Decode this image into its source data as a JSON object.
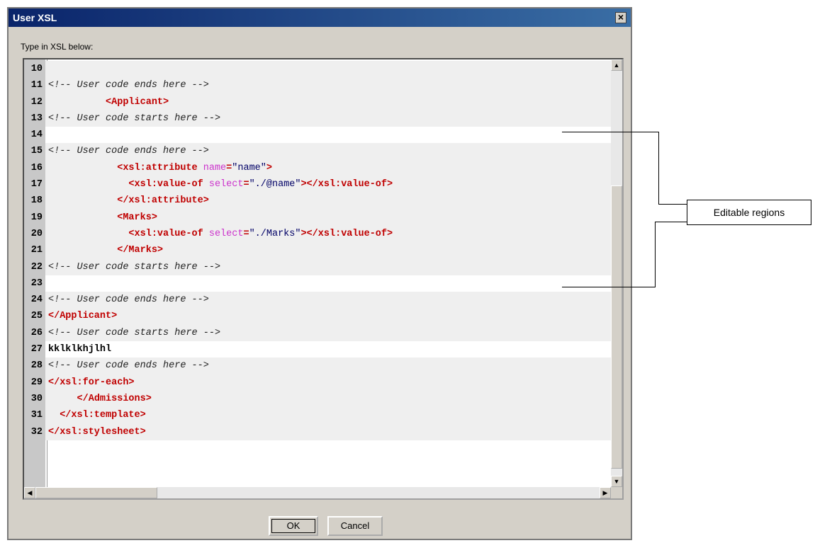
{
  "dialog": {
    "title": "User XSL",
    "close_label": "×",
    "prompt": "Type in XSL below:",
    "ok_label": "OK",
    "cancel_label": "Cancel"
  },
  "editor": {
    "lines": [
      {
        "num": "10",
        "kind": "readonly",
        "tokens": []
      },
      {
        "num": "11",
        "kind": "readonly",
        "tokens": [
          {
            "t": "comment",
            "v": "<!-- User code ends here -->"
          }
        ]
      },
      {
        "num": "12",
        "kind": "readonly",
        "tokens": [
          {
            "t": "text",
            "v": "          "
          },
          {
            "t": "tag",
            "v": "<Applicant>"
          }
        ]
      },
      {
        "num": "13",
        "kind": "readonly",
        "tokens": [
          {
            "t": "comment",
            "v": "<!-- User code starts here -->"
          }
        ]
      },
      {
        "num": "14",
        "kind": "editable",
        "tokens": []
      },
      {
        "num": "15",
        "kind": "readonly",
        "tokens": [
          {
            "t": "comment",
            "v": "<!-- User code ends here -->"
          }
        ]
      },
      {
        "num": "16",
        "kind": "readonly",
        "tokens": [
          {
            "t": "text",
            "v": "            "
          },
          {
            "t": "tag",
            "v": "<xsl:attribute "
          },
          {
            "t": "attrname",
            "v": "name"
          },
          {
            "t": "tag",
            "v": "="
          },
          {
            "t": "attrval",
            "v": "\"name\""
          },
          {
            "t": "tag",
            "v": ">"
          }
        ]
      },
      {
        "num": "17",
        "kind": "readonly",
        "tokens": [
          {
            "t": "text",
            "v": "              "
          },
          {
            "t": "tag",
            "v": "<xsl:value-of "
          },
          {
            "t": "attrname",
            "v": "select"
          },
          {
            "t": "tag",
            "v": "="
          },
          {
            "t": "attrval",
            "v": "\"./@name\""
          },
          {
            "t": "tag",
            "v": "></xsl:value-of>"
          }
        ]
      },
      {
        "num": "18",
        "kind": "readonly",
        "tokens": [
          {
            "t": "text",
            "v": "            "
          },
          {
            "t": "tag",
            "v": "</xsl:attribute>"
          }
        ]
      },
      {
        "num": "19",
        "kind": "readonly",
        "tokens": [
          {
            "t": "text",
            "v": "            "
          },
          {
            "t": "tag",
            "v": "<Marks>"
          }
        ]
      },
      {
        "num": "20",
        "kind": "readonly",
        "tokens": [
          {
            "t": "text",
            "v": "              "
          },
          {
            "t": "tag",
            "v": "<xsl:value-of "
          },
          {
            "t": "attrname",
            "v": "select"
          },
          {
            "t": "tag",
            "v": "="
          },
          {
            "t": "attrval",
            "v": "\"./Marks\""
          },
          {
            "t": "tag",
            "v": "></xsl:value-of>"
          }
        ]
      },
      {
        "num": "21",
        "kind": "readonly",
        "tokens": [
          {
            "t": "text",
            "v": "            "
          },
          {
            "t": "tag",
            "v": "</Marks>"
          }
        ]
      },
      {
        "num": "22",
        "kind": "readonly",
        "tokens": [
          {
            "t": "comment",
            "v": "<!-- User code starts here -->"
          }
        ]
      },
      {
        "num": "23",
        "kind": "editable",
        "tokens": []
      },
      {
        "num": "24",
        "kind": "readonly",
        "tokens": [
          {
            "t": "comment",
            "v": "<!-- User code ends here -->"
          }
        ]
      },
      {
        "num": "25",
        "kind": "readonly",
        "tokens": [
          {
            "t": "tag",
            "v": "</Applicant>"
          }
        ]
      },
      {
        "num": "26",
        "kind": "readonly",
        "tokens": [
          {
            "t": "comment",
            "v": "<!-- User code starts here -->"
          }
        ]
      },
      {
        "num": "27",
        "kind": "editable",
        "tokens": [
          {
            "t": "plain",
            "v": "kklklkhjlhl"
          }
        ]
      },
      {
        "num": "28",
        "kind": "readonly",
        "tokens": [
          {
            "t": "comment",
            "v": "<!-- User code ends here -->"
          }
        ]
      },
      {
        "num": "29",
        "kind": "readonly",
        "tokens": [
          {
            "t": "tag",
            "v": "</xsl:for-each>"
          }
        ]
      },
      {
        "num": "30",
        "kind": "readonly",
        "tokens": [
          {
            "t": "text",
            "v": "     "
          },
          {
            "t": "tag",
            "v": "</Admissions>"
          }
        ]
      },
      {
        "num": "31",
        "kind": "readonly",
        "tokens": [
          {
            "t": "text",
            "v": "  "
          },
          {
            "t": "tag",
            "v": "</xsl:template>"
          }
        ]
      },
      {
        "num": "32",
        "kind": "readonly",
        "tokens": [
          {
            "t": "tag",
            "v": "</xsl:stylesheet>"
          }
        ]
      }
    ]
  },
  "annotation": {
    "label": "Editable regions"
  }
}
